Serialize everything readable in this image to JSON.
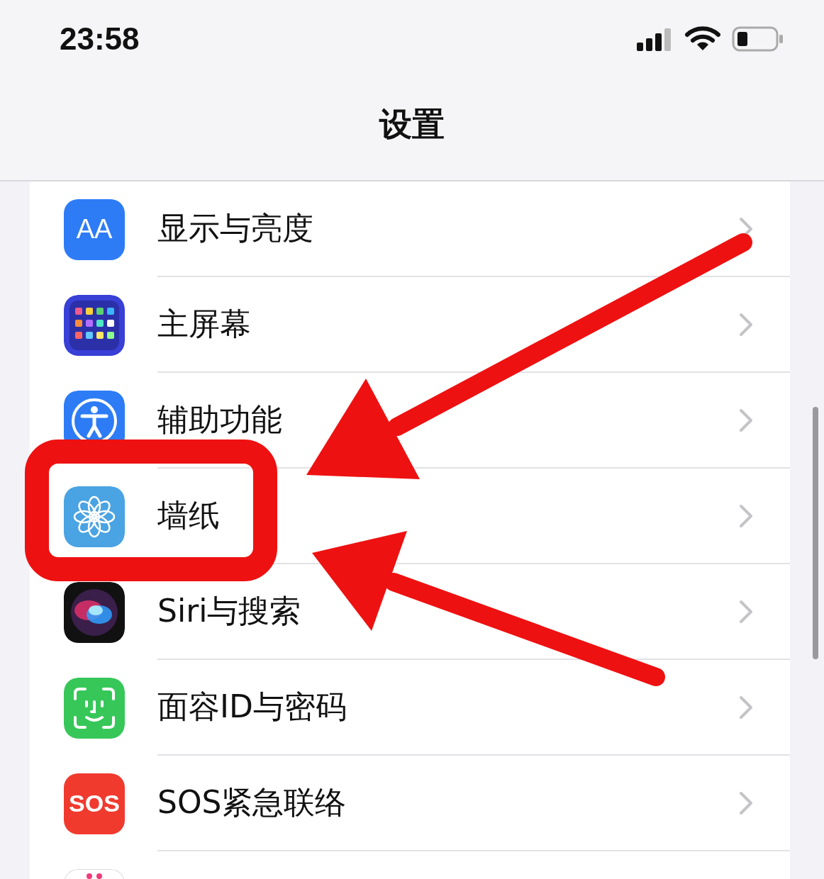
{
  "status_bar": {
    "time": "23:58"
  },
  "nav": {
    "title": "设置"
  },
  "rows": [
    {
      "badge": "AA",
      "label": "显示与亮度"
    },
    {
      "label": "主屏幕"
    },
    {
      "label": "辅助功能"
    },
    {
      "label": "墙纸"
    },
    {
      "label": "Siri与搜索"
    },
    {
      "label": "面容ID与密码"
    },
    {
      "badge": "SOS",
      "label": "SOS紧急联络"
    },
    {}
  ]
}
